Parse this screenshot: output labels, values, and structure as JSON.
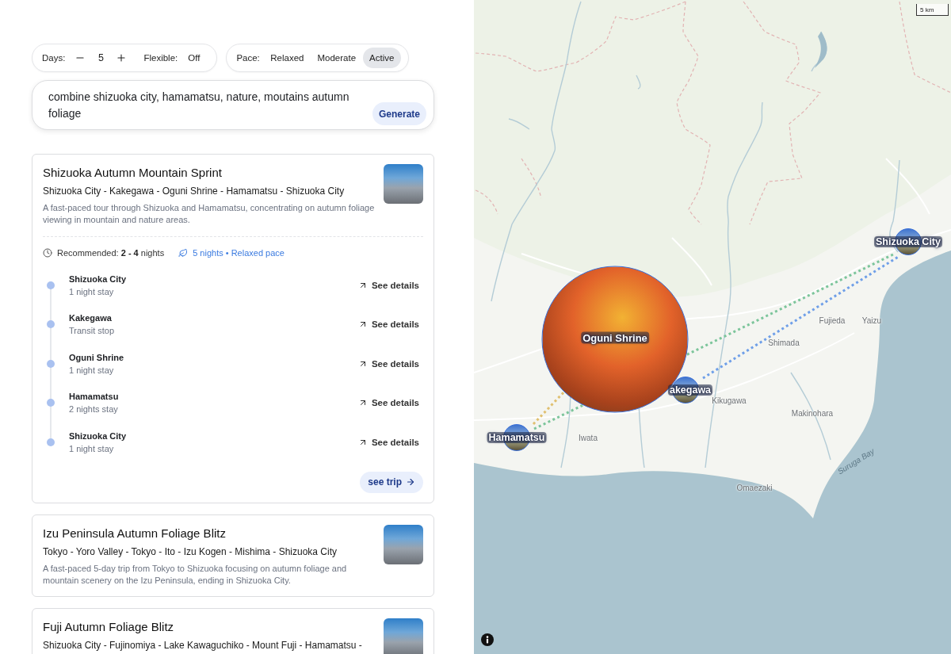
{
  "controls": {
    "days": {
      "label": "Days:",
      "value": "5"
    },
    "flexible": {
      "label": "Flexible:",
      "value": "Off"
    },
    "pace": {
      "label": "Pace:",
      "options": [
        {
          "label": "Relaxed",
          "selected": false
        },
        {
          "label": "Moderate",
          "selected": false
        },
        {
          "label": "Active",
          "selected": true
        }
      ]
    }
  },
  "prompt": {
    "value": "combine shizuoka city, hamamatsu, nature, moutains autumn foliage",
    "button": "Generate"
  },
  "trips": [
    {
      "title": "Shizuoka Autumn Mountain Sprint",
      "route": "Shizuoka City - Kakegawa - Oguni Shrine - Hamamatsu - Shizuoka City",
      "description": "A fast-paced tour through Shizuoka and Hamamatsu, concentrating on autumn foliage viewing in mountain and nature areas.",
      "expanded": true,
      "recommended": "Recommended: **2 - 4** nights",
      "plan": "5 nights • Relaxed pace",
      "stops": [
        {
          "name": "Shizuoka City",
          "note": "1 night stay",
          "action": "See details"
        },
        {
          "name": "Kakegawa",
          "note": "Transit stop",
          "action": "See details"
        },
        {
          "name": "Oguni Shrine",
          "note": "1 night stay",
          "action": "See details"
        },
        {
          "name": "Hamamatsu",
          "note": "2 nights stay",
          "action": "See details"
        },
        {
          "name": "Shizuoka City",
          "note": "1 night stay",
          "action": "See details"
        }
      ],
      "button": "see trip"
    },
    {
      "title": "Izu Peninsula Autumn Foliage Blitz",
      "route": "Tokyo - Yoro Valley - Tokyo - Ito - Izu Kogen - Mishima - Shizuoka City",
      "description": "A fast-paced 5-day trip from Tokyo to Shizuoka focusing on autumn foliage and mountain scenery on the Izu Peninsula, ending in Shizuoka City.",
      "expanded": false
    },
    {
      "title": "Fuji Autumn Foliage Blitz",
      "route": "Shizuoka City - Fujinomiya - Lake Kawaguchiko - Mount Fuji - Hamamatsu -",
      "expanded": false
    }
  ],
  "map": {
    "scale": "5 km",
    "places": [
      "Fujieda",
      "Yaizu",
      "Shimada",
      "Kikugawa",
      "Makinohara",
      "Iwata",
      "Omaezaki"
    ],
    "sea_label": "Suruga Bay",
    "routes": [
      {
        "color": "#7cc59b"
      },
      {
        "color": "#6f9fe8"
      },
      {
        "color": "#e0c070"
      }
    ],
    "markers": [
      {
        "label": "Shizuoka City",
        "expanded": false
      },
      {
        "label": "Oguni Shrine",
        "expanded": true
      },
      {
        "label": "akegawa",
        "expanded": false
      },
      {
        "label": "Hamamatsu",
        "expanded": false
      }
    ]
  }
}
